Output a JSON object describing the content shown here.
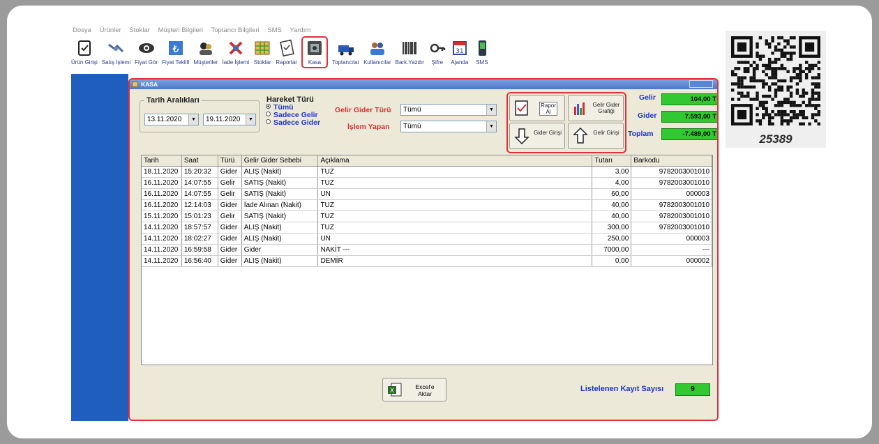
{
  "menu": [
    "Dosya",
    "Ürünler",
    "Stoklar",
    "Müşteri Bilgileri",
    "Toptancı Bilgileri",
    "SMS",
    "Yardım"
  ],
  "toolbar": [
    {
      "label": "Ürün Girişi",
      "icon": "product-entry-icon"
    },
    {
      "label": "Satış İşlemi",
      "icon": "sale-icon"
    },
    {
      "label": "Fiyat Gör",
      "icon": "price-view-icon"
    },
    {
      "label": "Fiyat Teklifi",
      "icon": "price-offer-icon"
    },
    {
      "label": "Müşteriler",
      "icon": "customers-icon"
    },
    {
      "label": "İade İşlemi",
      "icon": "return-icon"
    },
    {
      "label": "Stoklar",
      "icon": "stocks-icon"
    },
    {
      "label": "Raporlar",
      "icon": "reports-icon"
    },
    {
      "label": "Kasa",
      "icon": "cash-register-icon"
    },
    {
      "label": "Toptancılar",
      "icon": "wholesalers-icon"
    },
    {
      "label": "Kullanıcılar",
      "icon": "users-icon"
    },
    {
      "label": "Bark.Yazdır",
      "icon": "barcode-print-icon"
    },
    {
      "label": "Şifre",
      "icon": "password-icon"
    },
    {
      "label": "Ajanda",
      "icon": "agenda-icon"
    },
    {
      "label": "SMS",
      "icon": "sms-icon"
    }
  ],
  "window": {
    "title": "KASA",
    "date_range": {
      "legend": "Tarih Aralıkları",
      "from": "13.11.2020",
      "to": "19.11.2020"
    },
    "movement": {
      "legend": "Hareket Türü",
      "options": [
        "Tümü",
        "Sadece Gelir",
        "Sadece Gider"
      ],
      "selected": "Tümü"
    },
    "filters": {
      "type_label": "Gelir Gider Türü",
      "type_value": "Tümü",
      "user_label": "İşlem Yapan",
      "user_value": "Tümü"
    },
    "buttons": {
      "report": "Rapor Al",
      "chart": "Gelir Gider Grafiği",
      "expense_entry": "Gider Girişi",
      "income_entry": "Gelir Girişi"
    },
    "summary": {
      "income_label": "Gelir",
      "income_value": "104,00 T",
      "expense_label": "Gider",
      "expense_value": "7.593,00 T",
      "total_label": "Toplam",
      "total_value": "-7.489,00 T"
    },
    "table": {
      "columns": [
        "Tarih",
        "Saat",
        "Türü",
        "Gelir Gider Sebebi",
        "Açıklama",
        "Tutarı",
        "Barkodu"
      ],
      "rows": [
        [
          "18.11.2020",
          "15:20:32",
          "Gider",
          "ALIŞ (Nakit)",
          "TUZ",
          "3,00",
          "9782003001010"
        ],
        [
          "16.11.2020",
          "14:07:55",
          "Gelir",
          "SATIŞ (Nakit)",
          "TUZ",
          "4,00",
          "9782003001010"
        ],
        [
          "16.11.2020",
          "14:07:55",
          "Gelir",
          "SATIŞ (Nakit)",
          "UN",
          "60,00",
          "000003"
        ],
        [
          "16.11.2020",
          "12:14:03",
          "Gider",
          "İade Alınan (Nakit)",
          "TUZ",
          "40,00",
          "9782003001010"
        ],
        [
          "15.11.2020",
          "15:01:23",
          "Gelir",
          "SATIŞ (Nakit)",
          "TUZ",
          "40,00",
          "9782003001010"
        ],
        [
          "14.11.2020",
          "18:57:57",
          "Gider",
          "ALIŞ (Nakit)",
          "TUZ",
          "300,00",
          "9782003001010"
        ],
        [
          "14.11.2020",
          "18:02:27",
          "Gider",
          "ALIŞ (Nakit)",
          "UN",
          "250,00",
          "000003"
        ],
        [
          "14.11.2020",
          "16:59:58",
          "Gider",
          "Gider",
          "NAKİT ---",
          "7000,00",
          "---"
        ],
        [
          "14.11.2020",
          "16:56:40",
          "Gider",
          "ALIŞ (Nakit)",
          "DEMİR",
          "0,00",
          "000002"
        ]
      ]
    },
    "excel_button": "Excel'e Aktar",
    "record_count_label": "Listelenen Kayıt Sayısı",
    "record_count": "9"
  },
  "qr_code_number": "25389",
  "colors": {
    "highlight": "#e0303a",
    "accent_blue": "#1f5ebd",
    "sum_green": "#32c832",
    "label_red": "#d23232",
    "label_blue": "#1e34c8"
  }
}
